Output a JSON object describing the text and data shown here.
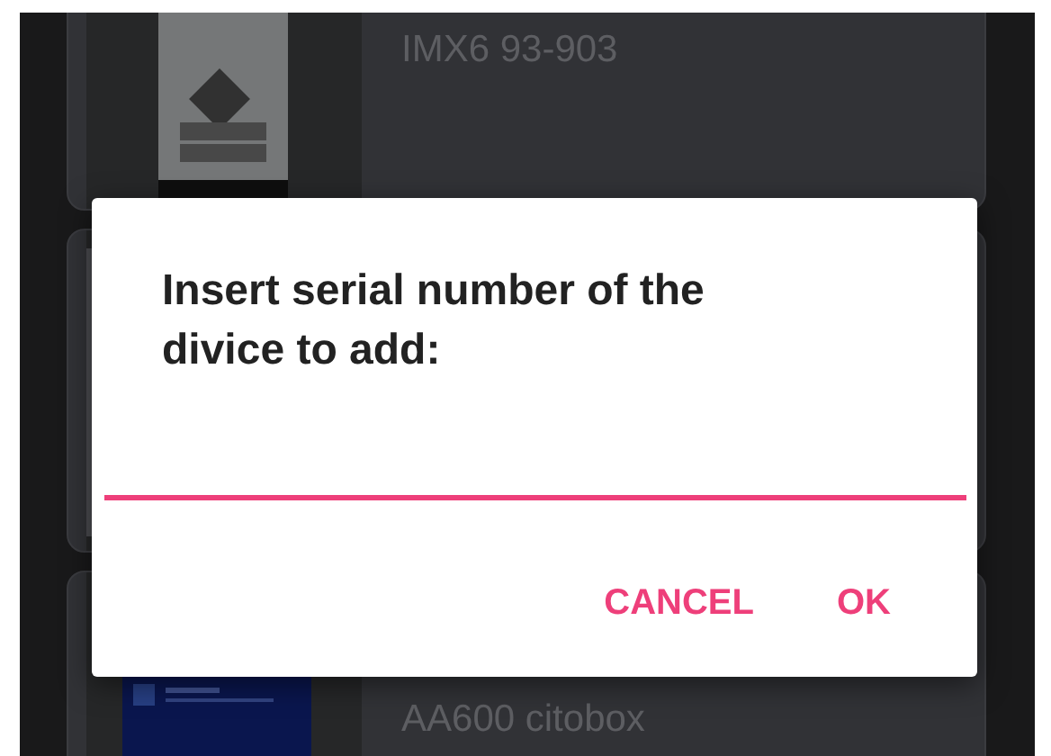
{
  "cards": [
    {
      "image": {
        "kind": "picture"
      },
      "title": "IMX6 93-903"
    },
    {
      "image": {
        "kind": "picture"
      }
    },
    {
      "image": {
        "kind": "picture"
      },
      "title": "AA600 citobox"
    }
  ],
  "dialog": {
    "title": "Insert serial number of the divice to add:",
    "buttons": [
      "CANCEL",
      "OK"
    ]
  }
}
